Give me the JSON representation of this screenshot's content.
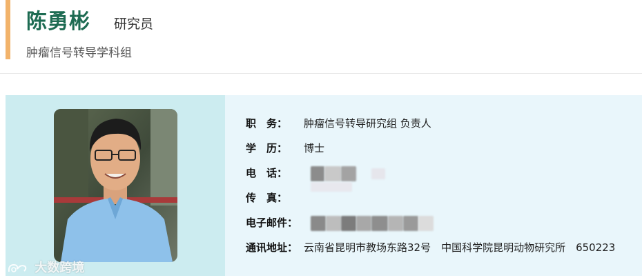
{
  "header": {
    "name": "陈勇彬",
    "title": "研究员",
    "group": "肿瘤信号转导学科组"
  },
  "profile": {
    "rows": [
      {
        "label": "职　务：",
        "value": "肿瘤信号转导研究组 负责人"
      },
      {
        "label": "学　历：",
        "value": "博士"
      },
      {
        "label": "电　话：",
        "value": ""
      },
      {
        "label": "传　真：",
        "value": ""
      },
      {
        "label": "电子邮件：",
        "value": ""
      },
      {
        "label": "通讯地址：",
        "value": "云南省昆明市教场东路32号　中国科学院昆明动物研究所　650223"
      }
    ]
  },
  "watermark": {
    "text": "大数跨境"
  },
  "colors": {
    "accent": "#f2b36b",
    "name": "#1d6b52",
    "photo_panel": "#ccecf0",
    "card_bg": "#e9f6fb"
  }
}
